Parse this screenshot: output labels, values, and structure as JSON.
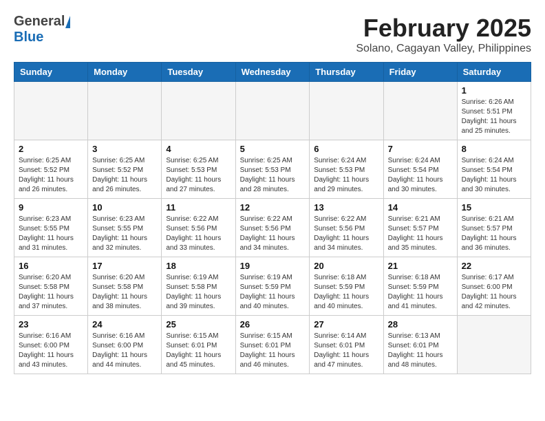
{
  "header": {
    "logo_general": "General",
    "logo_blue": "Blue",
    "month_title": "February 2025",
    "location": "Solano, Cagayan Valley, Philippines"
  },
  "weekdays": [
    "Sunday",
    "Monday",
    "Tuesday",
    "Wednesday",
    "Thursday",
    "Friday",
    "Saturday"
  ],
  "weeks": [
    [
      {
        "day": "",
        "info": ""
      },
      {
        "day": "",
        "info": ""
      },
      {
        "day": "",
        "info": ""
      },
      {
        "day": "",
        "info": ""
      },
      {
        "day": "",
        "info": ""
      },
      {
        "day": "",
        "info": ""
      },
      {
        "day": "1",
        "info": "Sunrise: 6:26 AM\nSunset: 5:51 PM\nDaylight: 11 hours\nand 25 minutes."
      }
    ],
    [
      {
        "day": "2",
        "info": "Sunrise: 6:25 AM\nSunset: 5:52 PM\nDaylight: 11 hours\nand 26 minutes."
      },
      {
        "day": "3",
        "info": "Sunrise: 6:25 AM\nSunset: 5:52 PM\nDaylight: 11 hours\nand 26 minutes."
      },
      {
        "day": "4",
        "info": "Sunrise: 6:25 AM\nSunset: 5:53 PM\nDaylight: 11 hours\nand 27 minutes."
      },
      {
        "day": "5",
        "info": "Sunrise: 6:25 AM\nSunset: 5:53 PM\nDaylight: 11 hours\nand 28 minutes."
      },
      {
        "day": "6",
        "info": "Sunrise: 6:24 AM\nSunset: 5:53 PM\nDaylight: 11 hours\nand 29 minutes."
      },
      {
        "day": "7",
        "info": "Sunrise: 6:24 AM\nSunset: 5:54 PM\nDaylight: 11 hours\nand 30 minutes."
      },
      {
        "day": "8",
        "info": "Sunrise: 6:24 AM\nSunset: 5:54 PM\nDaylight: 11 hours\nand 30 minutes."
      }
    ],
    [
      {
        "day": "9",
        "info": "Sunrise: 6:23 AM\nSunset: 5:55 PM\nDaylight: 11 hours\nand 31 minutes."
      },
      {
        "day": "10",
        "info": "Sunrise: 6:23 AM\nSunset: 5:55 PM\nDaylight: 11 hours\nand 32 minutes."
      },
      {
        "day": "11",
        "info": "Sunrise: 6:22 AM\nSunset: 5:56 PM\nDaylight: 11 hours\nand 33 minutes."
      },
      {
        "day": "12",
        "info": "Sunrise: 6:22 AM\nSunset: 5:56 PM\nDaylight: 11 hours\nand 34 minutes."
      },
      {
        "day": "13",
        "info": "Sunrise: 6:22 AM\nSunset: 5:56 PM\nDaylight: 11 hours\nand 34 minutes."
      },
      {
        "day": "14",
        "info": "Sunrise: 6:21 AM\nSunset: 5:57 PM\nDaylight: 11 hours\nand 35 minutes."
      },
      {
        "day": "15",
        "info": "Sunrise: 6:21 AM\nSunset: 5:57 PM\nDaylight: 11 hours\nand 36 minutes."
      }
    ],
    [
      {
        "day": "16",
        "info": "Sunrise: 6:20 AM\nSunset: 5:58 PM\nDaylight: 11 hours\nand 37 minutes."
      },
      {
        "day": "17",
        "info": "Sunrise: 6:20 AM\nSunset: 5:58 PM\nDaylight: 11 hours\nand 38 minutes."
      },
      {
        "day": "18",
        "info": "Sunrise: 6:19 AM\nSunset: 5:58 PM\nDaylight: 11 hours\nand 39 minutes."
      },
      {
        "day": "19",
        "info": "Sunrise: 6:19 AM\nSunset: 5:59 PM\nDaylight: 11 hours\nand 40 minutes."
      },
      {
        "day": "20",
        "info": "Sunrise: 6:18 AM\nSunset: 5:59 PM\nDaylight: 11 hours\nand 40 minutes."
      },
      {
        "day": "21",
        "info": "Sunrise: 6:18 AM\nSunset: 5:59 PM\nDaylight: 11 hours\nand 41 minutes."
      },
      {
        "day": "22",
        "info": "Sunrise: 6:17 AM\nSunset: 6:00 PM\nDaylight: 11 hours\nand 42 minutes."
      }
    ],
    [
      {
        "day": "23",
        "info": "Sunrise: 6:16 AM\nSunset: 6:00 PM\nDaylight: 11 hours\nand 43 minutes."
      },
      {
        "day": "24",
        "info": "Sunrise: 6:16 AM\nSunset: 6:00 PM\nDaylight: 11 hours\nand 44 minutes."
      },
      {
        "day": "25",
        "info": "Sunrise: 6:15 AM\nSunset: 6:01 PM\nDaylight: 11 hours\nand 45 minutes."
      },
      {
        "day": "26",
        "info": "Sunrise: 6:15 AM\nSunset: 6:01 PM\nDaylight: 11 hours\nand 46 minutes."
      },
      {
        "day": "27",
        "info": "Sunrise: 6:14 AM\nSunset: 6:01 PM\nDaylight: 11 hours\nand 47 minutes."
      },
      {
        "day": "28",
        "info": "Sunrise: 6:13 AM\nSunset: 6:01 PM\nDaylight: 11 hours\nand 48 minutes."
      },
      {
        "day": "",
        "info": ""
      }
    ]
  ]
}
